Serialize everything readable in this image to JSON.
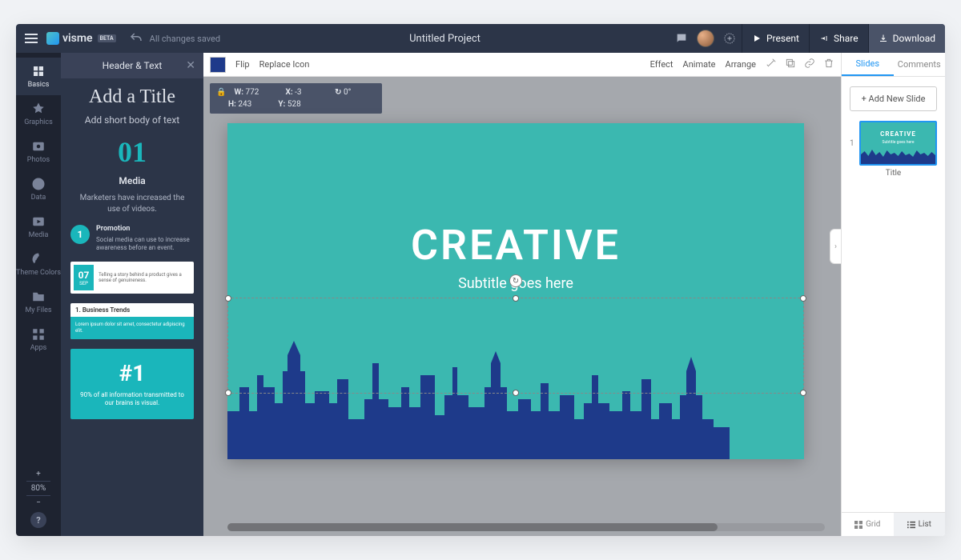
{
  "topbar": {
    "brand": "visme",
    "beta": "BETA",
    "saved": "All changes saved",
    "project_title": "Untitled Project",
    "present": "Present",
    "share": "Share",
    "download": "Download"
  },
  "rail": {
    "items": [
      "Basics",
      "Graphics",
      "Photos",
      "Data",
      "Media",
      "Theme Colors",
      "My Files",
      "Apps"
    ],
    "zoom": "80%"
  },
  "panel": {
    "header": "Header & Text",
    "title_tmpl": "Add a Title",
    "sub_tmpl": "Add short body of text",
    "num": "01",
    "media_h": "Media",
    "media_p": "Marketers have increased the use of videos.",
    "promo_badge": "1",
    "promo_h": "Promotion",
    "promo_p": "Social media can use to increase awareness before an event.",
    "date_day": "07",
    "date_mon": "SEP",
    "date_txt": "Telling a story behind a product gives a sense of genuineness.",
    "card_h": "1. Business Trends",
    "card_p": "Lorem ipsum dolor sit amet, consectetur adipiscing elit.",
    "big_h": "#1",
    "big_p": "90% of all information transmitted to our brains is visual."
  },
  "ctx": {
    "flip": "Flip",
    "replace": "Replace Icon",
    "effect": "Effect",
    "animate": "Animate",
    "arrange": "Arrange"
  },
  "dims": {
    "w_label": "W:",
    "w": "772",
    "x_label": "X:",
    "x": "-3",
    "deg_label": "↻",
    "deg": "0°",
    "h_label": "H:",
    "h": "243",
    "y_label": "Y:",
    "y": "528"
  },
  "slide": {
    "title": "CREATIVE",
    "subtitle": "Subtitle goes here"
  },
  "rpanel": {
    "tab_slides": "Slides",
    "tab_comments": "Comments",
    "add": "+ Add New Slide",
    "thumb_label": "Title",
    "grid": "Grid",
    "list": "List"
  }
}
